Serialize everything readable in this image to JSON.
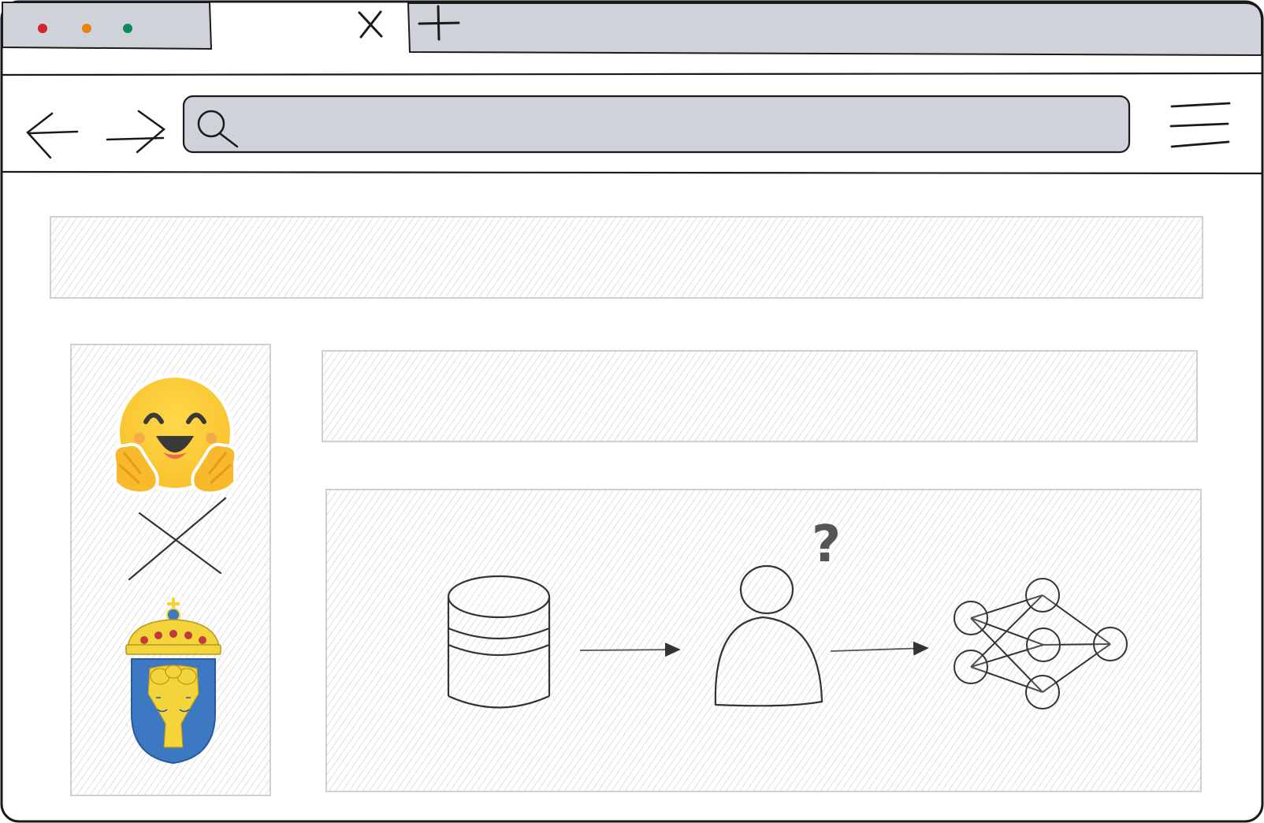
{
  "window": {
    "controls": [
      {
        "name": "close",
        "color": "#d0262d"
      },
      {
        "name": "minimize",
        "color": "#e8820e"
      },
      {
        "name": "maximize",
        "color": "#0b8a5c"
      }
    ],
    "tab_close_icon": "close-icon",
    "new_tab_icon": "plus-icon"
  },
  "toolbar": {
    "back_icon": "arrow-left-icon",
    "forward_icon": "arrow-right-icon",
    "search_icon": "search-icon",
    "menu_icon": "hamburger-icon",
    "address_value": "",
    "address_placeholder": ""
  },
  "page": {
    "logos": {
      "top": "hugging-face-emoji-logo",
      "separator": "cross-icon",
      "bottom": "swedish-coat-of-arms-logo"
    },
    "flow": {
      "steps": [
        "database-icon",
        "person-icon",
        "neural-network-icon"
      ],
      "question_mark": "?"
    }
  },
  "colors": {
    "outline": "#1a1a1a",
    "chrome_fill": "#cfd3d9",
    "hatch": "#c8c8c8",
    "emoji_yellow": "#fcd33a",
    "emoji_orange": "#f6ae20",
    "shield_blue": "#3d78c3",
    "shield_gold": "#f4d43b"
  }
}
